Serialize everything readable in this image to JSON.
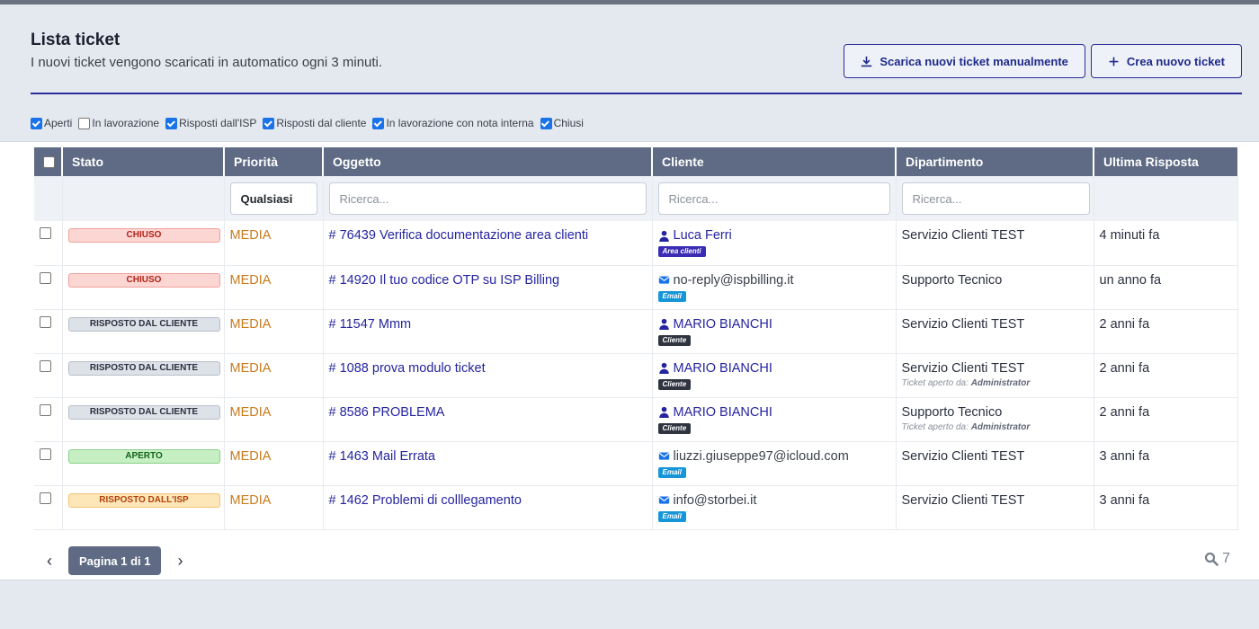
{
  "header": {
    "title": "Lista ticket",
    "subtitle": "I nuovi ticket vengono scaricati in automatico ogni 3 minuti.",
    "download_label": "Scarica nuovi ticket manualmente",
    "create_label": "Crea nuovo ticket"
  },
  "filters": [
    {
      "label": "Aperti",
      "checked": true
    },
    {
      "label": "In lavorazione",
      "checked": false
    },
    {
      "label": "Risposti dall'ISP",
      "checked": true
    },
    {
      "label": "Risposti dal cliente",
      "checked": true
    },
    {
      "label": "In lavorazione con nota interna",
      "checked": true
    },
    {
      "label": "Chiusi",
      "checked": true
    }
  ],
  "table": {
    "columns": [
      "Stato",
      "Priorità",
      "Oggetto",
      "Cliente",
      "Dipartimento",
      "Ultima Risposta"
    ],
    "priority_filter": "Qualsiasi",
    "search_placeholder": "Ricerca...",
    "rows": [
      {
        "status": "CHIUSO",
        "status_kind": "chiuso",
        "priority": "MEDIA",
        "subject": "# 76439 Verifica documentazione area clienti",
        "client": "Luca Ferri",
        "client_type": "user",
        "tag": "Area clienti",
        "tag_kind": "area",
        "department": "Servizio Clienti TEST",
        "opened_by_label": "",
        "opened_by": "",
        "last_reply": "4 minuti fa"
      },
      {
        "status": "CHIUSO",
        "status_kind": "chiuso",
        "priority": "MEDIA",
        "subject": "# 14920 Il tuo codice OTP su ISP Billing",
        "client": "no-reply@ispbilling.it",
        "client_type": "mail",
        "tag": "Email",
        "tag_kind": "email",
        "department": "Supporto Tecnico",
        "opened_by_label": "",
        "opened_by": "",
        "last_reply": "un anno fa"
      },
      {
        "status": "RISPOSTO DAL CLIENTE",
        "status_kind": "cliente",
        "priority": "MEDIA",
        "subject": "# 11547 Mmm",
        "client": "MARIO BIANCHI",
        "client_type": "user",
        "tag": "Cliente",
        "tag_kind": "cliente",
        "department": "Servizio Clienti TEST",
        "opened_by_label": "",
        "opened_by": "",
        "last_reply": "2 anni fa"
      },
      {
        "status": "RISPOSTO DAL CLIENTE",
        "status_kind": "cliente",
        "priority": "MEDIA",
        "subject": "# 1088 prova modulo ticket",
        "client": "MARIO BIANCHI",
        "client_type": "user",
        "tag": "Cliente",
        "tag_kind": "cliente",
        "department": "Servizio Clienti TEST",
        "opened_by_label": "Ticket aperto da:",
        "opened_by": "Administrator",
        "last_reply": "2 anni fa"
      },
      {
        "status": "RISPOSTO DAL CLIENTE",
        "status_kind": "cliente",
        "priority": "MEDIA",
        "subject": "# 8586 PROBLEMA",
        "client": "MARIO BIANCHI",
        "client_type": "user",
        "tag": "Cliente",
        "tag_kind": "cliente",
        "department": "Supporto Tecnico",
        "opened_by_label": "Ticket aperto da:",
        "opened_by": "Administrator",
        "last_reply": "2 anni fa"
      },
      {
        "status": "APERTO",
        "status_kind": "aperto",
        "priority": "MEDIA",
        "subject": "# 1463 Mail Errata",
        "client": "liuzzi.giuseppe97@icloud.com",
        "client_type": "mail",
        "tag": "Email",
        "tag_kind": "email",
        "department": "Servizio Clienti TEST",
        "opened_by_label": "",
        "opened_by": "",
        "last_reply": "3 anni fa"
      },
      {
        "status": "RISPOSTO DALL'ISP",
        "status_kind": "isp",
        "priority": "MEDIA",
        "subject": "# 1462 Problemi di colllegamento",
        "client": "info@storbei.it",
        "client_type": "mail",
        "tag": "Email",
        "tag_kind": "email",
        "department": "Servizio Clienti TEST",
        "opened_by_label": "",
        "opened_by": "",
        "last_reply": "3 anni fa"
      }
    ]
  },
  "pagination": {
    "label": "Pagina 1 di 1",
    "prev": "‹",
    "next": "›",
    "total": "7"
  }
}
